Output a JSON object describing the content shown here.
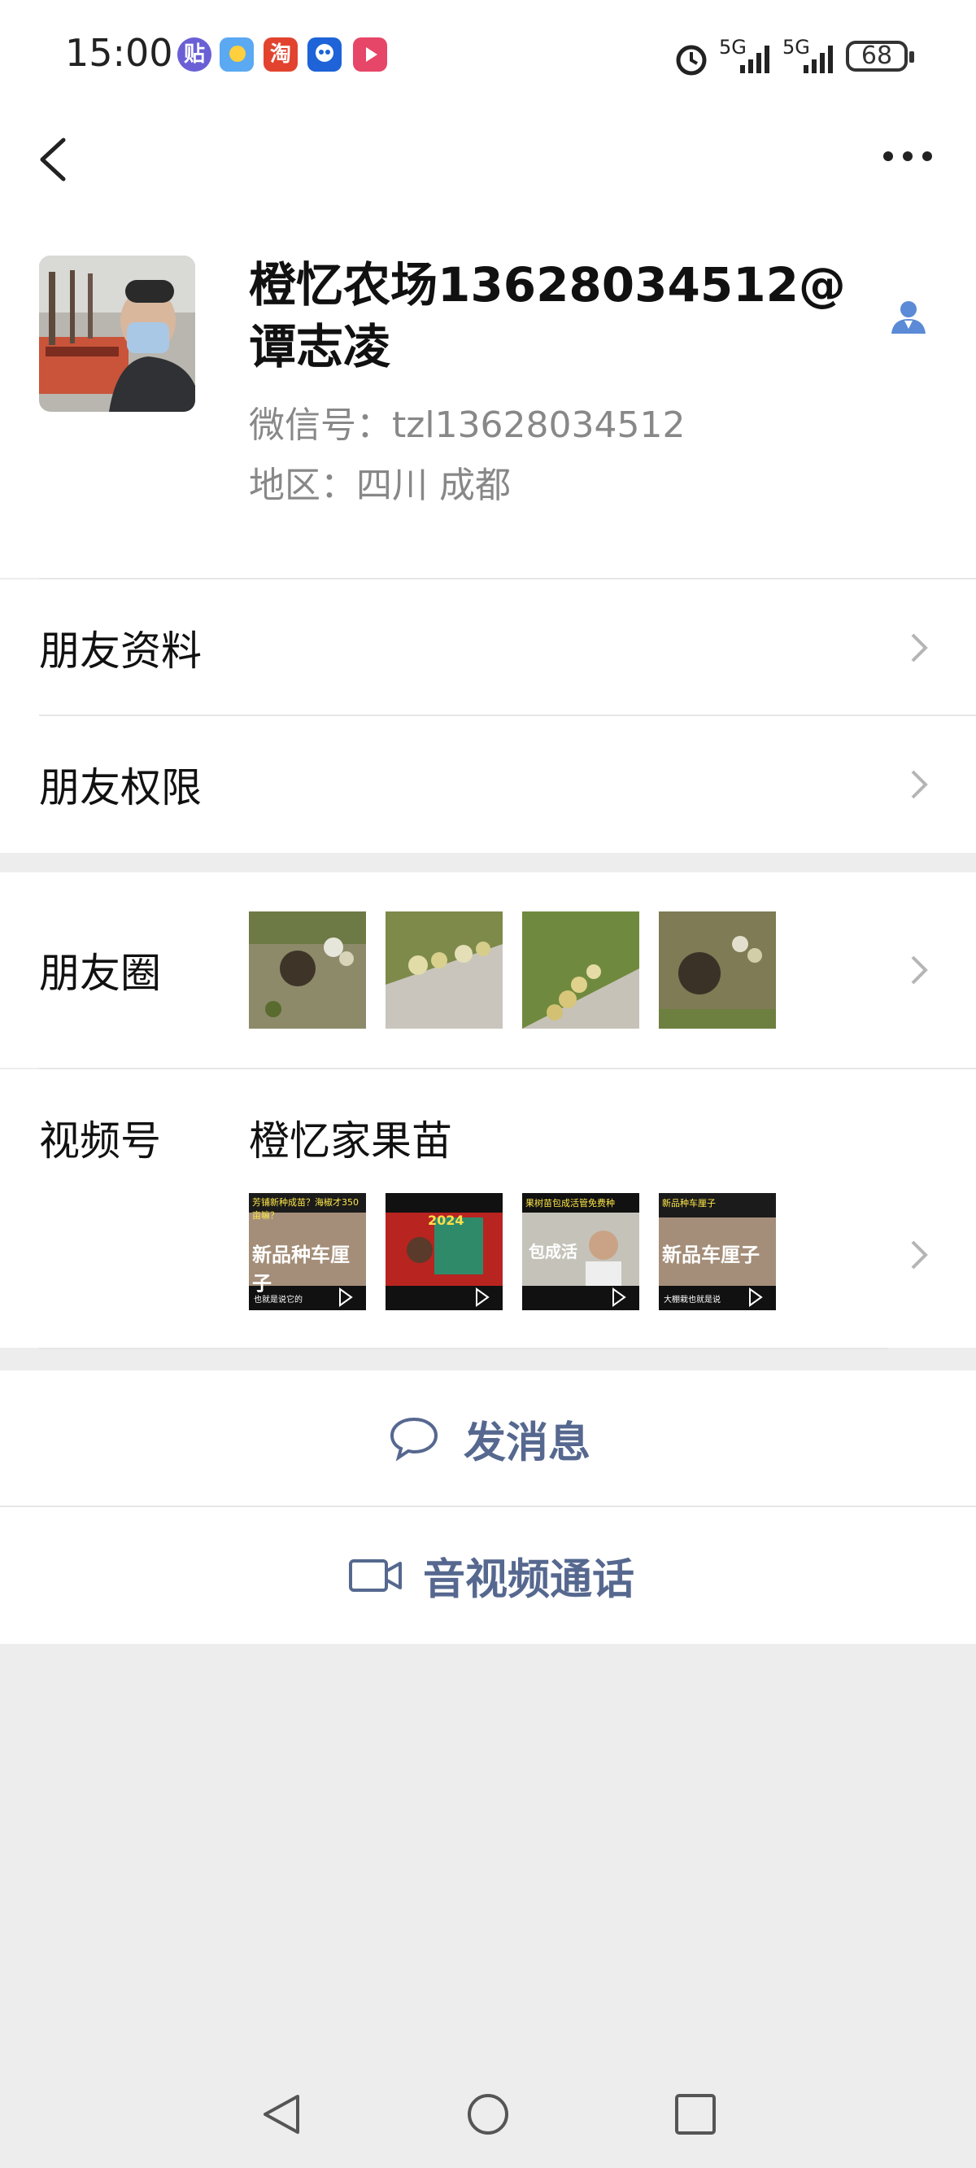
{
  "status_bar": {
    "time": "15:00",
    "apps": [
      "贴",
      "",
      "淘",
      "",
      ""
    ],
    "signal_1": "5G",
    "signal_2": "5G",
    "battery": "68"
  },
  "profile": {
    "name": "橙忆农场13628034512@谭志凌",
    "wechat_id": "微信号：tzl13628034512",
    "region": "地区：四川  成都"
  },
  "menu": {
    "friend_info": "朋友资料",
    "friend_permissions": "朋友权限"
  },
  "moments": {
    "label": "朋友圈"
  },
  "channels": {
    "label": "视频号",
    "name": "橙忆家果苗",
    "videos": [
      {
        "top": "芳铺新种成苗？海椒才350亩嘛？",
        "big": "新品种车厘子",
        "bottom": "也就是说它的"
      },
      {
        "top": "",
        "big": "2024",
        "bottom": ""
      },
      {
        "top": "果树苗包成活管免费种",
        "big": "包成活",
        "bottom": ""
      },
      {
        "top": "新品种车厘子",
        "big": "新品车厘子",
        "bottom": "大棚栽也就是说"
      }
    ]
  },
  "actions": {
    "message": "发消息",
    "call": "音视频通话"
  },
  "colors": {
    "accent": "#56688f",
    "background": "#ededed",
    "person_icon": "#5b8ad6"
  }
}
